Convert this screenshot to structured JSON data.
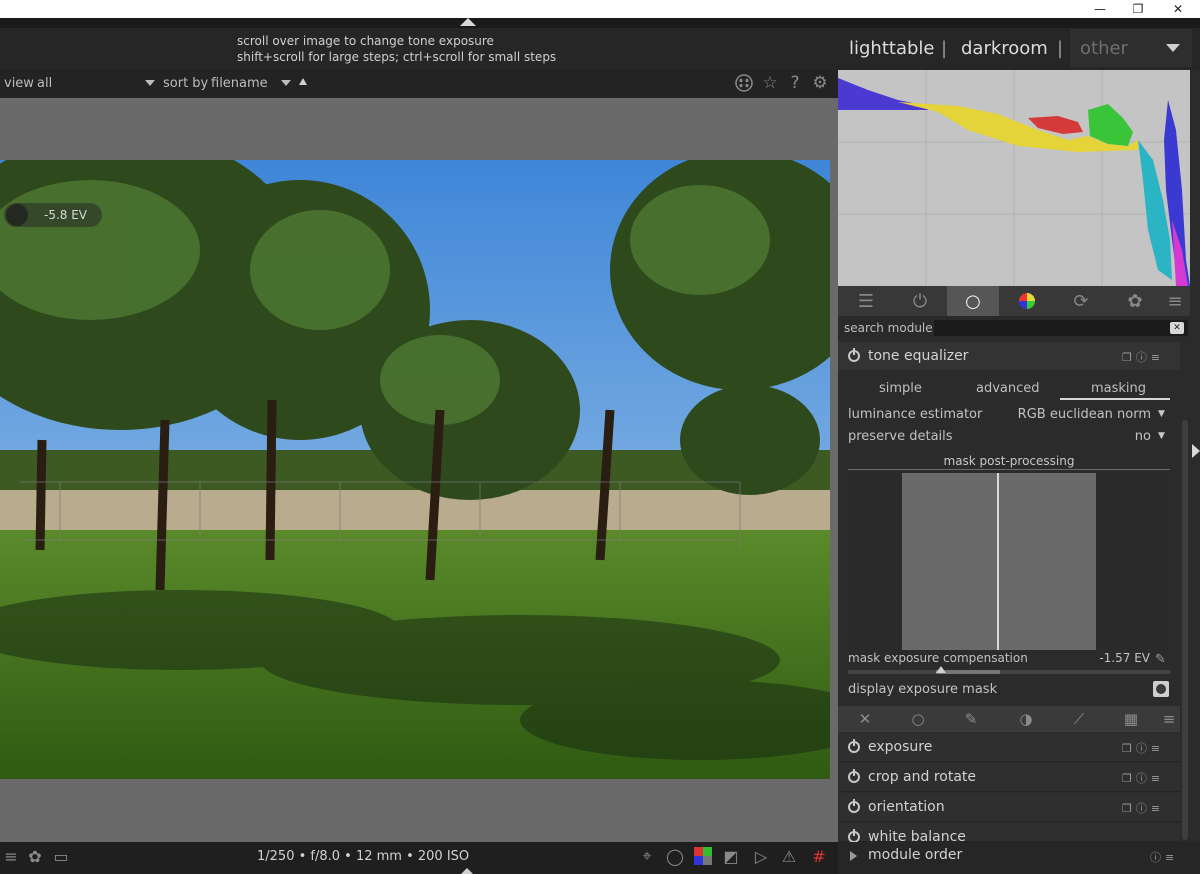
{
  "window": {
    "minimize": "—",
    "maximize": "❐",
    "close": "✕"
  },
  "hint": {
    "line1": "scroll over image to change tone exposure",
    "line2": "shift+scroll for large steps; ctrl+scroll for small steps"
  },
  "views": {
    "lighttable": "lighttable",
    "separator": "|",
    "darkroom": "darkroom",
    "other": "other"
  },
  "filterbar": {
    "view_label": "view",
    "view_value": "all",
    "sort_label": "sort by",
    "sort_value": "filename"
  },
  "overlay": {
    "exposure_readout": "-5.8 EV"
  },
  "search": {
    "label": "search module",
    "value": ""
  },
  "module": {
    "title": "tone equalizer",
    "tabs": [
      "simple",
      "advanced",
      "masking"
    ],
    "active_tab": "masking",
    "luminance_label": "luminance estimator",
    "luminance_value": "RGB euclidean norm",
    "preserve_label": "preserve details",
    "preserve_value": "no",
    "section": "mask post-processing",
    "compensation_label": "mask exposure compensation",
    "compensation_value": "-1.57 EV",
    "compensation_slider": 0.37,
    "display_mask_label": "display exposure mask"
  },
  "modules": [
    "exposure",
    "crop and rotate",
    "orientation",
    "white balance"
  ],
  "module_order": "module order",
  "bottom": {
    "info": "1/250 • f/8.0 • 12 mm • 200 ISO"
  },
  "colors": {
    "panel": "#2b2b2b",
    "center": "#6a6a6a",
    "accent": "#d8d8d8"
  },
  "icons": {
    "filter": [
      "presets-icon",
      "star-icon",
      "help-icon",
      "gear-icon"
    ],
    "module_tabs": [
      "active-modules-icon",
      "power-icon",
      "circle-icon",
      "color-wheel-icon",
      "loop-icon",
      "aperture-icon",
      "menu-icon"
    ],
    "mask_tools": [
      "close-icon",
      "circle-icon",
      "pencil-icon",
      "gradient-icon",
      "brush-icon",
      "checker-icon",
      "menu-icon"
    ],
    "bottom": [
      "menu-icon",
      "styles-icon",
      "display-icon",
      "focus-peaking-icon",
      "bulb-icon",
      "color-assessment-icon",
      "raw-overexposed-icon",
      "softproof-icon",
      "gamut-warning-icon",
      "guides-icon"
    ]
  }
}
